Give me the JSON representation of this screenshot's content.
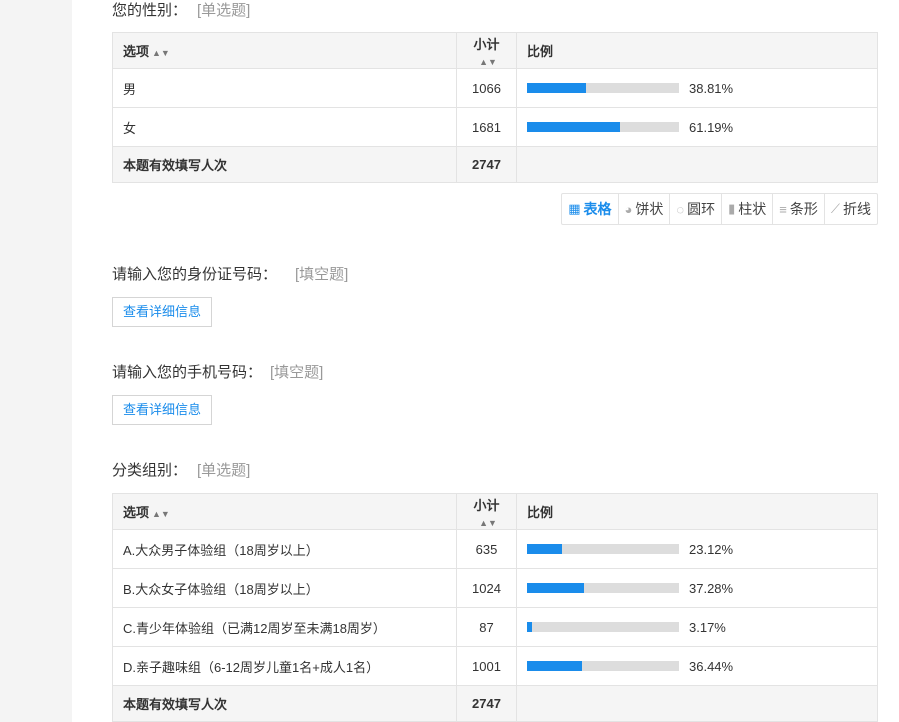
{
  "q1": {
    "title": "您的性别：",
    "type": "[单选题]",
    "headers": {
      "option": "选项",
      "count": "小计",
      "ratio": "比例"
    },
    "rows": [
      {
        "label": "男",
        "count": "1066",
        "pct": "38.81%",
        "value": 38.81
      },
      {
        "label": "女",
        "count": "1681",
        "pct": "61.19%",
        "value": 61.19
      }
    ],
    "total_label": "本题有效填写人次",
    "total": "2747"
  },
  "chart_toolbar": {
    "items": [
      {
        "label": "表格",
        "icon": "table-icon"
      },
      {
        "label": "饼状",
        "icon": "pie-icon"
      },
      {
        "label": "圆环",
        "icon": "ring-icon"
      },
      {
        "label": "柱状",
        "icon": "column-icon"
      },
      {
        "label": "条形",
        "icon": "bar-icon"
      },
      {
        "label": "折线",
        "icon": "line-icon"
      }
    ],
    "active": "表格"
  },
  "q2": {
    "title": "请输入您的身份证号码：",
    "type": "[填空题]",
    "button": "查看详细信息"
  },
  "q3": {
    "title": "请输入您的手机号码：",
    "type": "[填空题]",
    "button": "查看详细信息"
  },
  "q4": {
    "title": "分类组别：",
    "type": "[单选题]",
    "headers": {
      "option": "选项",
      "count": "小计",
      "ratio": "比例"
    },
    "rows": [
      {
        "label": "A.大众男子体验组（18周岁以上）",
        "count": "635",
        "pct": "23.12%",
        "value": 23.12
      },
      {
        "label": "B.大众女子体验组（18周岁以上）",
        "count": "1024",
        "pct": "37.28%",
        "value": 37.28
      },
      {
        "label": "C.青少年体验组（已满12周岁至未满18周岁）",
        "count": "87",
        "pct": "3.17%",
        "value": 3.17
      },
      {
        "label": "D.亲子趣味组（6-12周岁儿童1名+成人1名）",
        "count": "1001",
        "pct": "36.44%",
        "value": 36.44
      }
    ],
    "total_label": "本题有效填写人次",
    "total": "2747"
  },
  "colors": {
    "accent": "#1a8ceb",
    "bar_bg": "#dddddd",
    "header_bg": "#f5f5f5"
  }
}
